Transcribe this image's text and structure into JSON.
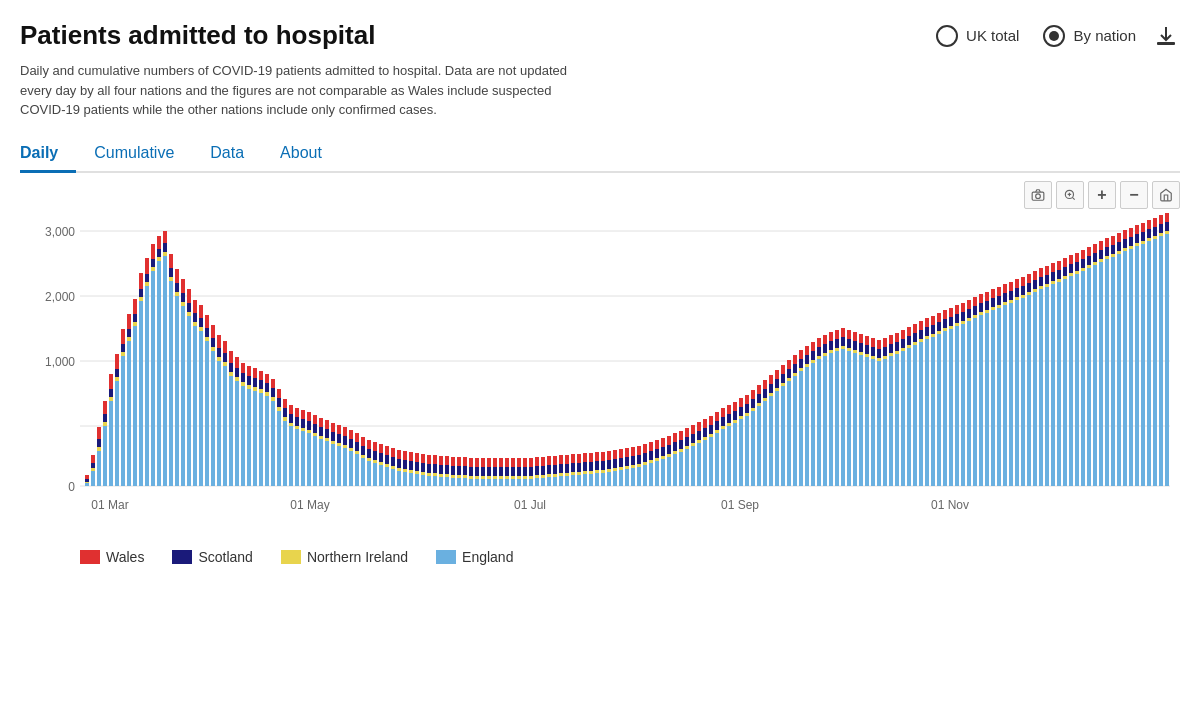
{
  "header": {
    "title": "Patients admitted to hospital",
    "download_label": "Download",
    "radio_options": [
      {
        "id": "uk_total",
        "label": "UK total",
        "selected": false
      },
      {
        "id": "by_nation",
        "label": "By nation",
        "selected": true
      }
    ]
  },
  "description": "Daily and cumulative numbers of COVID-19 patients admitted to hospital. Data are not updated every day by all four nations and the figures are not comparable as Wales include suspected COVID-19 patients while the other nations include only confirmed cases.",
  "tabs": [
    {
      "id": "daily",
      "label": "Daily",
      "active": true
    },
    {
      "id": "cumulative",
      "label": "Cumulative",
      "active": false
    },
    {
      "id": "data",
      "label": "Data",
      "active": false
    },
    {
      "id": "about",
      "label": "About",
      "active": false
    }
  ],
  "chart": {
    "y_axis": [
      "3,000",
      "2,000",
      "1,000",
      "0"
    ],
    "x_axis": [
      "01 Mar",
      "01 May",
      "01 Jul",
      "01 Sep",
      "01 Nov"
    ],
    "toolbar": {
      "camera": "📷",
      "zoom": "🔍",
      "plus": "+",
      "minus": "−",
      "home": "⌂"
    }
  },
  "legend": [
    {
      "id": "wales",
      "label": "Wales",
      "color": "#e03030"
    },
    {
      "id": "scotland",
      "label": "Scotland",
      "color": "#1a1a7a"
    },
    {
      "id": "northern_ireland",
      "label": "Northern Ireland",
      "color": "#e8d44d"
    },
    {
      "id": "england",
      "label": "England",
      "color": "#6ab0e0"
    }
  ],
  "colors": {
    "wales": "#e03030",
    "scotland": "#1a1a7a",
    "northern_ireland": "#e8d44d",
    "england": "#6ab0e0",
    "tab_active": "#0a6eb5",
    "grid_line": "#e0e0e0"
  }
}
